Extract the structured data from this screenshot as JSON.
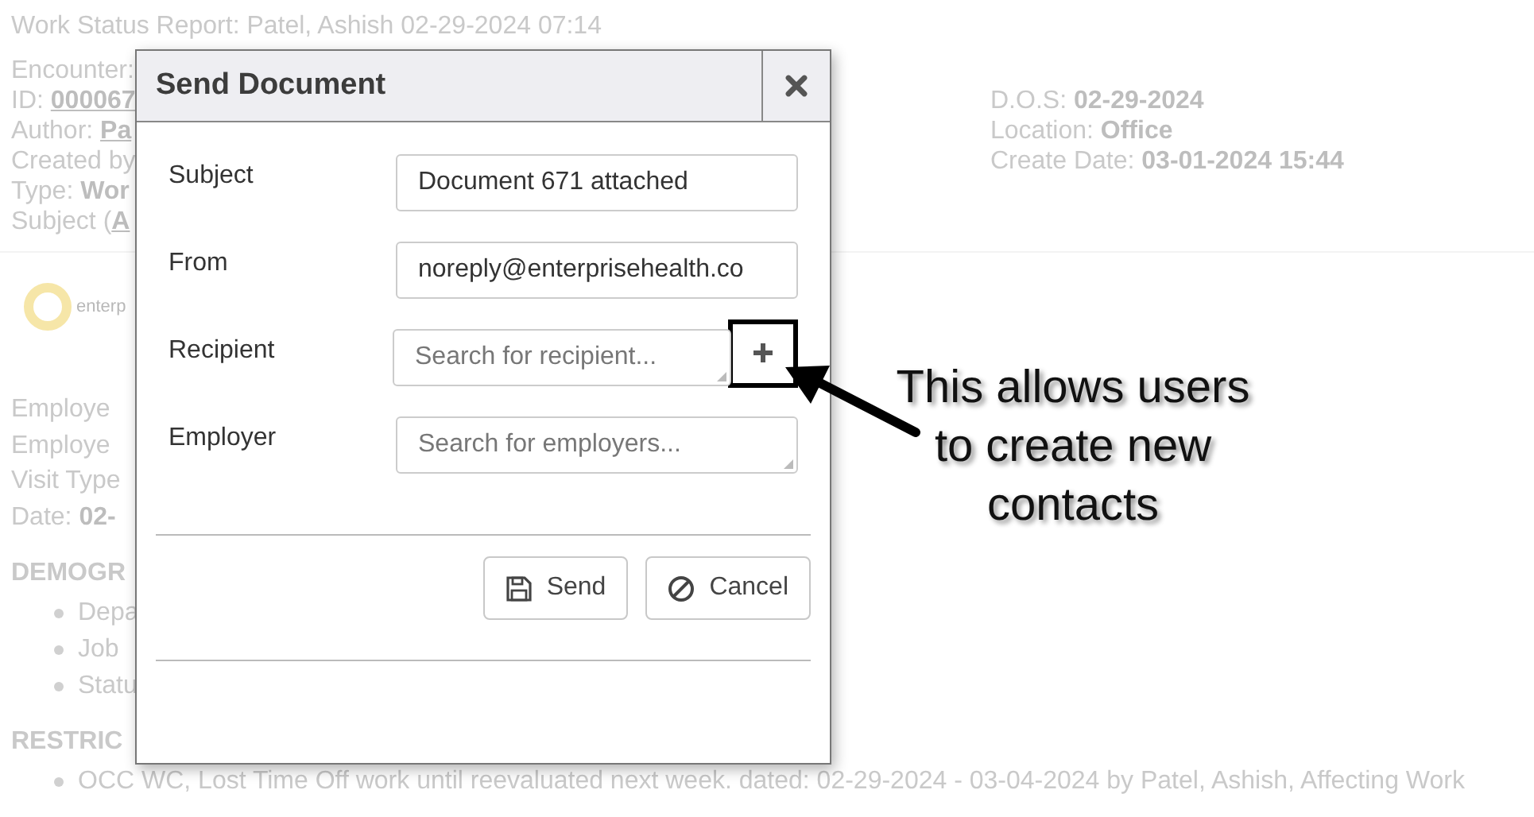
{
  "report": {
    "title": "Work Status Report: Patel, Ashish 02-29-2024 07:14",
    "info_left": [
      {
        "kind": "plain",
        "label": "Encounter:"
      },
      {
        "kind": "link",
        "label": "ID: ",
        "value": "000067"
      },
      {
        "kind": "link",
        "label": "Author: ",
        "value": "Pa"
      },
      {
        "kind": "plain",
        "label": "Created by"
      },
      {
        "kind": "bold",
        "label": "Type: ",
        "value": "Wor"
      },
      {
        "kind": "link",
        "label": "Subject (",
        "value": "A"
      }
    ],
    "info_right": [
      {
        "kind": "bold",
        "label": "D.O.S: ",
        "value": "02-29-2024"
      },
      {
        "kind": "bold",
        "label": "Location: ",
        "value": "Office"
      },
      {
        "kind": "bold",
        "label": "Create Date: ",
        "value": "03-01-2024 15:44"
      }
    ],
    "logo_text": "enterp",
    "employee": [
      {
        "kind": "plain",
        "label": "Employe"
      },
      {
        "kind": "plain",
        "label": "Employe"
      },
      {
        "kind": "plain",
        "label": "Visit Type"
      },
      {
        "kind": "bold",
        "label": "Date: ",
        "value": "02-"
      }
    ],
    "sections": [
      {
        "heading": "DEMOGR",
        "items": [
          "Depa",
          "Job",
          "Statu"
        ]
      },
      {
        "heading": "RESTRIC",
        "items": [
          "OCC WC, Lost Time Off work until reevaluated next week. dated: 02-29-2024 - 03-04-2024 by Patel, Ashish, Affecting Work"
        ]
      }
    ]
  },
  "dialog": {
    "title": "Send Document",
    "fields": [
      {
        "kind": "text",
        "label": "Subject",
        "value": "Document 671 attached"
      },
      {
        "kind": "text",
        "label": "From",
        "value": "noreply@enterprisehealth.co"
      },
      {
        "kind": "search_add",
        "label": "Recipient",
        "placeholder": "Search for recipient..."
      },
      {
        "kind": "search",
        "label": "Employer",
        "placeholder": "Search for employers..."
      }
    ],
    "buttons": [
      {
        "kind": "save",
        "label": "Send"
      },
      {
        "kind": "cancel",
        "label": "Cancel"
      }
    ]
  },
  "annotation": {
    "lines": [
      "This allows users",
      "to create new",
      "contacts"
    ]
  }
}
